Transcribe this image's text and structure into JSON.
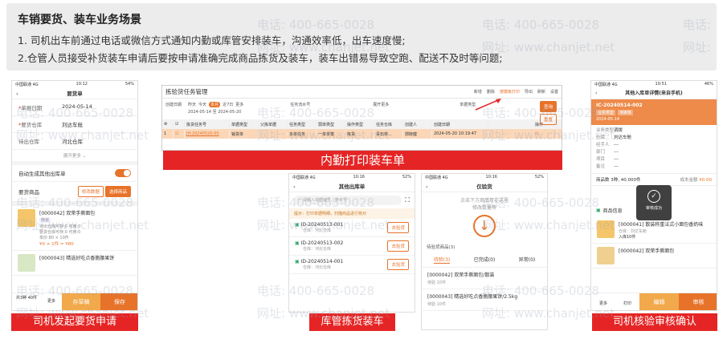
{
  "header": {
    "title": "车销要货、装车业务场景",
    "line1": "1. 司机出车前通过电话或微信方式通知内勤或库管安排装车，沟通效率低，出车速度慢;",
    "line2": "2.仓管人员接受补货装车申请后要按申请准确完成商品拣货及装车，装车出错易导致空跑、配送不及时等问题;"
  },
  "watermarks": {
    "phone": "电话: 400-665-0028",
    "site": "网址: www.chanjet.net",
    "phone_short": "电话:",
    "site_short": "网址:",
    "num": "400-665-0028",
    "url": "www.chanjet.net"
  },
  "captions": {
    "driver_request": "司机发起要货申请",
    "print": "内勤打印装车单",
    "picking": "库管拣货装车",
    "review": "司机核验审核确认"
  },
  "phone1": {
    "status_left": "中国联通 4G",
    "status_time": "10:12",
    "status_right": "54%",
    "title": "要货单",
    "rows": [
      {
        "k": "单据日期",
        "v": "2024-05-14",
        "req": "*"
      },
      {
        "k": "要货仓库",
        "v": "刘达车舱",
        "req": "*"
      },
      {
        "k": "待出仓库",
        "v": "河北仓库",
        "req": ""
      }
    ],
    "expand": "展开更多",
    "auto_label": "自动生成其他出库单",
    "goods_label": "要货商品",
    "btn_edit": "修改数据",
    "btn_select": "选择商品",
    "items": [
      {
        "name": "[0000042] 双荣手撕面包",
        "tag": "散装",
        "l1": "待出仓库可存:0  可用:0",
        "l2": "要货仓库可存:0  可用:0",
        "l3": "单价:80  ×  10件",
        "price": "¥0 × 1件 = ¥80"
      },
      {
        "name": "[0000043] 精选好吃点香脆腰果饼",
        "tag": "",
        "l1": "",
        "l2": "",
        "l3": "",
        "price": ""
      }
    ],
    "footer_count": "共3种 40件",
    "footer_more": "更多",
    "btn_draft": "存草稿",
    "btn_save": "保存"
  },
  "desktop": {
    "title": "拣验货任务管理",
    "toolbar": [
      "新增",
      "删除",
      "按模板打印",
      "导出",
      "刷新",
      "设置"
    ],
    "filter_date_label": "创建日期",
    "filter_tabs": [
      "昨天",
      "今天",
      "本月",
      "近7日",
      "更多"
    ],
    "filter_range": "2024-05-14  至  2024-05-20",
    "task_no_label": "任务流水号",
    "expand": "展开更多",
    "order_label": "单据类型",
    "btn_query": "查询",
    "btn_reset": "重置",
    "columns": [
      "",
      "拣货任务号",
      "单据类型",
      "父拣单据",
      "任务类型",
      "弱单类型",
      "操作类型",
      "任务仓库",
      "创建人",
      "创建日期",
      "",
      "操作"
    ],
    "rows": [
      [
        "1",
        "JH-20240520-00",
        "销货单",
        "",
        "多单任务",
        "一单多笼",
        "拣货",
        "青石林...",
        "郭晓健",
        "2024-05-20 10:19:47",
        "",
        "⊙"
      ]
    ]
  },
  "phone2": {
    "status_left": "中国联通 4G",
    "status_time": "10:16",
    "status_right": "52%",
    "title": "其他出库单",
    "search_placeholder": "请输入单据编号、参考号",
    "tip": "提示：打印单据明细，扫描商品进行核对",
    "items": [
      {
        "no": "ID-20240513-001",
        "wh": "仓库：河北仓库",
        "btn": "去验货"
      },
      {
        "no": "ID-20240513-002",
        "wh": "仓库：河北仓库",
        "btn": "去验货"
      },
      {
        "no": "ID-20240514-001",
        "wh": "仓库：河北仓库",
        "btn": "去验货"
      }
    ]
  },
  "phone3": {
    "status_left": "中国联通 4G",
    "status_time": "10:16",
    "status_right": "52%",
    "title": "仅验货",
    "hint1": "点击下方商品可在这里",
    "hint2": "修改数量等",
    "section": "待验货商品(3)",
    "tabs": [
      "待验(3)",
      "已完成(0)",
      "异常(0)"
    ],
    "items": [
      {
        "name": "[0000042] 双荣手撕面包/散装",
        "qty": "待验 10件"
      },
      {
        "name": "[0000043] 精选好吃点香脆腰果饼/2.5kg",
        "qty": "待验 10件"
      }
    ]
  },
  "phone4": {
    "status_left": "中国联通 4G",
    "status_time": "10:51",
    "status_right": "46%",
    "title": "其他入库单详情(来自手机)",
    "doc_no": "IC-20240514-002",
    "tags": [
      "业务类型",
      "待审核"
    ],
    "date": "2024-05-14",
    "fields": [
      {
        "k": "业务类型",
        "v": "调拨"
      },
      {
        "k": "仓库",
        "v": "刘达车舱"
      },
      {
        "k": "经手人",
        "v": "---"
      },
      {
        "k": "部门",
        "v": "---"
      },
      {
        "k": "项目",
        "v": "---"
      },
      {
        "k": "备注",
        "v": "---"
      }
    ],
    "summary_left": "商品数 3种, 40.000件",
    "summary_right_label": "成本金额",
    "summary_right": "¥0.00",
    "review_ok": "审核成功",
    "goods_header": "商品信息",
    "items": [
      {
        "name": "[0000041] 散装称重法式小面包香奶味",
        "wh": "仓库：刘达车舱",
        "qty": "入库10件"
      },
      {
        "name": "[0000042] 双荣手撕面包",
        "wh": "",
        "qty": ""
      }
    ],
    "footer": [
      "更多",
      "打印"
    ],
    "btn_edit": "编辑",
    "btn_review": "审核"
  }
}
